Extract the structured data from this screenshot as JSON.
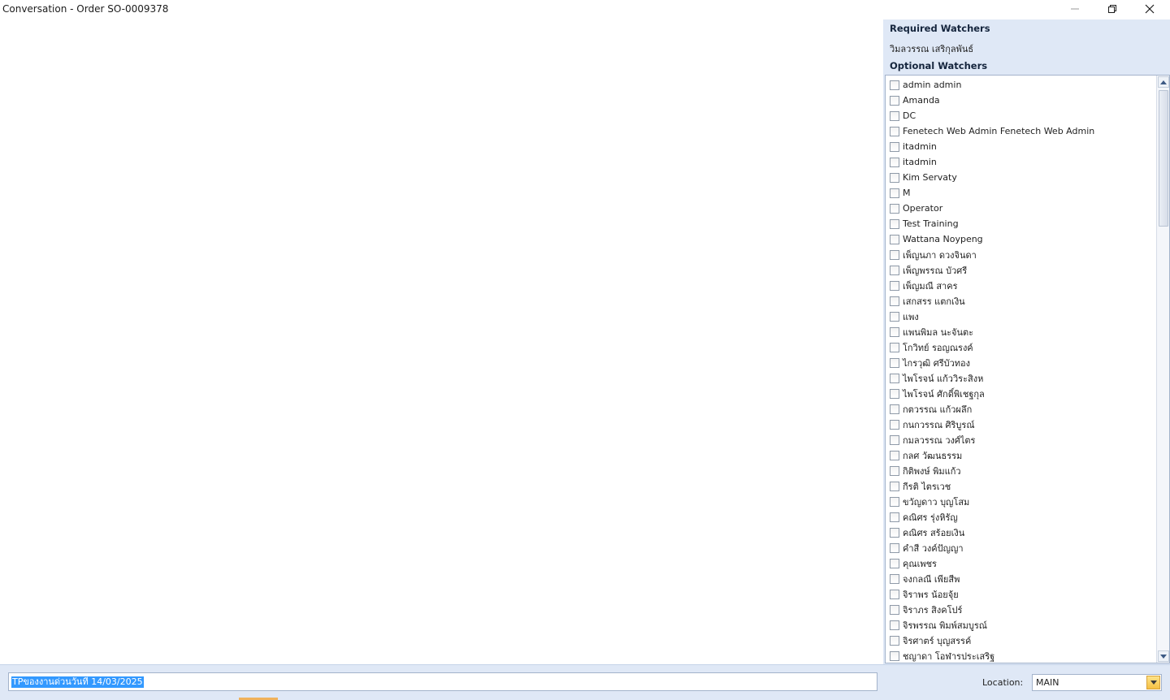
{
  "window": {
    "title": "Conversation - Order SO-0009378"
  },
  "watchers": {
    "required_header": "Required Watchers",
    "required_name": "วิมลวรรณ เสริกุลพันธ์",
    "optional_header": "Optional Watchers",
    "optional_items": [
      {
        "label": "admin admin",
        "checked": false
      },
      {
        "label": "Amanda",
        "checked": false
      },
      {
        "label": "DC",
        "checked": false
      },
      {
        "label": "Fenetech Web Admin Fenetech Web Admin",
        "checked": false
      },
      {
        "label": "itadmin",
        "checked": false
      },
      {
        "label": "itadmin",
        "checked": false
      },
      {
        "label": "Kim Servaty",
        "checked": false
      },
      {
        "label": "M",
        "checked": false
      },
      {
        "label": "Operator",
        "checked": false
      },
      {
        "label": "Test Training",
        "checked": false
      },
      {
        "label": "Wattana Noypeng",
        "checked": false
      },
      {
        "label": "เพ็ญนภา ดวงจินดา",
        "checked": false
      },
      {
        "label": "เพ็ญพรรณ บัวศรี",
        "checked": false
      },
      {
        "label": "เพ็ญมณี สาคร",
        "checked": false
      },
      {
        "label": "เสกสรร แตกเงิน",
        "checked": false
      },
      {
        "label": "แพง",
        "checked": false
      },
      {
        "label": "แพนพิมล นะจันตะ",
        "checked": false
      },
      {
        "label": "โกวิทย์ รอญณรงค์",
        "checked": false
      },
      {
        "label": "ไกรวุฒิ ศรีบัวทอง",
        "checked": false
      },
      {
        "label": "ไพโรจน์ แก้ววิระสิงห",
        "checked": false
      },
      {
        "label": "ไพโรจน์ ศักดิ์พิเชฐกุล",
        "checked": false
      },
      {
        "label": "กตวรรณ แก้วผลึก",
        "checked": false
      },
      {
        "label": "กนกวรรณ ศิริบูรณ์",
        "checked": false
      },
      {
        "label": "กมลวรรณ   วงศ์ไตร",
        "checked": false
      },
      {
        "label": "กลศ วัฒนธรรม",
        "checked": false
      },
      {
        "label": "กิติพงษ์   พิมแก้ว",
        "checked": false
      },
      {
        "label": "กีรติ  ไตรเวช",
        "checked": false
      },
      {
        "label": "ขวัญดาว บุญโสม",
        "checked": false
      },
      {
        "label": "คณิศร รุ่งหิรัญ",
        "checked": false
      },
      {
        "label": "คณิศร สร้อยเงิน",
        "checked": false
      },
      {
        "label": "คำสี วงค์ปัญญา",
        "checked": false
      },
      {
        "label": "คุณเพชร",
        "checked": false
      },
      {
        "label": "จงกลณี   เพียสีพ",
        "checked": false
      },
      {
        "label": "จิราพร น้อยจุ้ย",
        "checked": false
      },
      {
        "label": "จิราภร สิงคโปร์",
        "checked": false
      },
      {
        "label": "จิรพรรณ พิมพ์สมบูรณ์",
        "checked": false
      },
      {
        "label": "จิรศาตร์ บุญสรรค์",
        "checked": false
      },
      {
        "label": "ชญาดา โอฬารประเสริฐ",
        "checked": false
      }
    ]
  },
  "composer": {
    "message": "TPของงานด่วนวันที่ 14/03/2025",
    "location_label": "Location:",
    "location_value": "MAIN"
  },
  "colors": {
    "panel_bg": "#dfe8f6",
    "selection": "#3399ff",
    "dropdown_accent": "#f5c043"
  }
}
